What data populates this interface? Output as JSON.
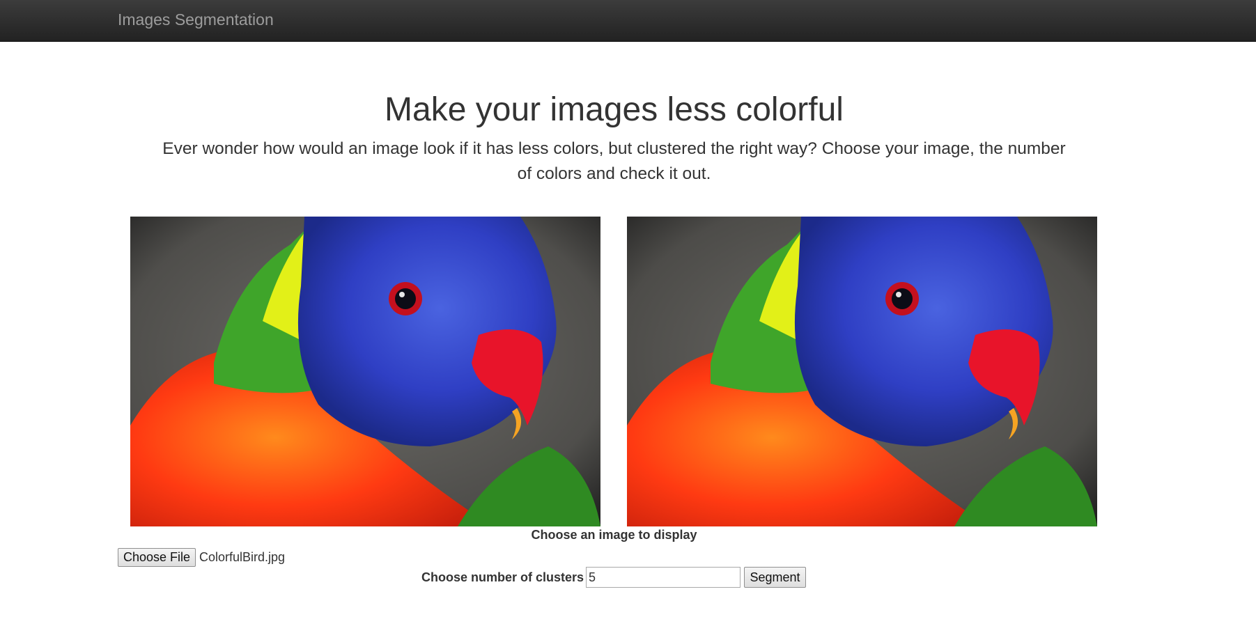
{
  "navbar": {
    "brand": "Images Segmentation"
  },
  "hero": {
    "title": "Make your images less colorful",
    "subtitle": "Ever wonder how would an image look if it has less colors, but clustered the right way? Choose your image, the number of colors and check it out."
  },
  "images": {
    "left": {
      "subject": "rainbow lorikeet parrot"
    },
    "right": {
      "subject": "rainbow lorikeet parrot (segmented)"
    }
  },
  "upload": {
    "caption": "Choose an image to display",
    "button_label": "Choose File",
    "file_name": "ColorfulBird.jpg"
  },
  "clusters": {
    "label": "Choose number of clusters",
    "value": "5",
    "button_label": "Segment"
  },
  "colors": {
    "navbar": "#222222",
    "brand_text": "#9d9d9d",
    "text": "#333333"
  }
}
